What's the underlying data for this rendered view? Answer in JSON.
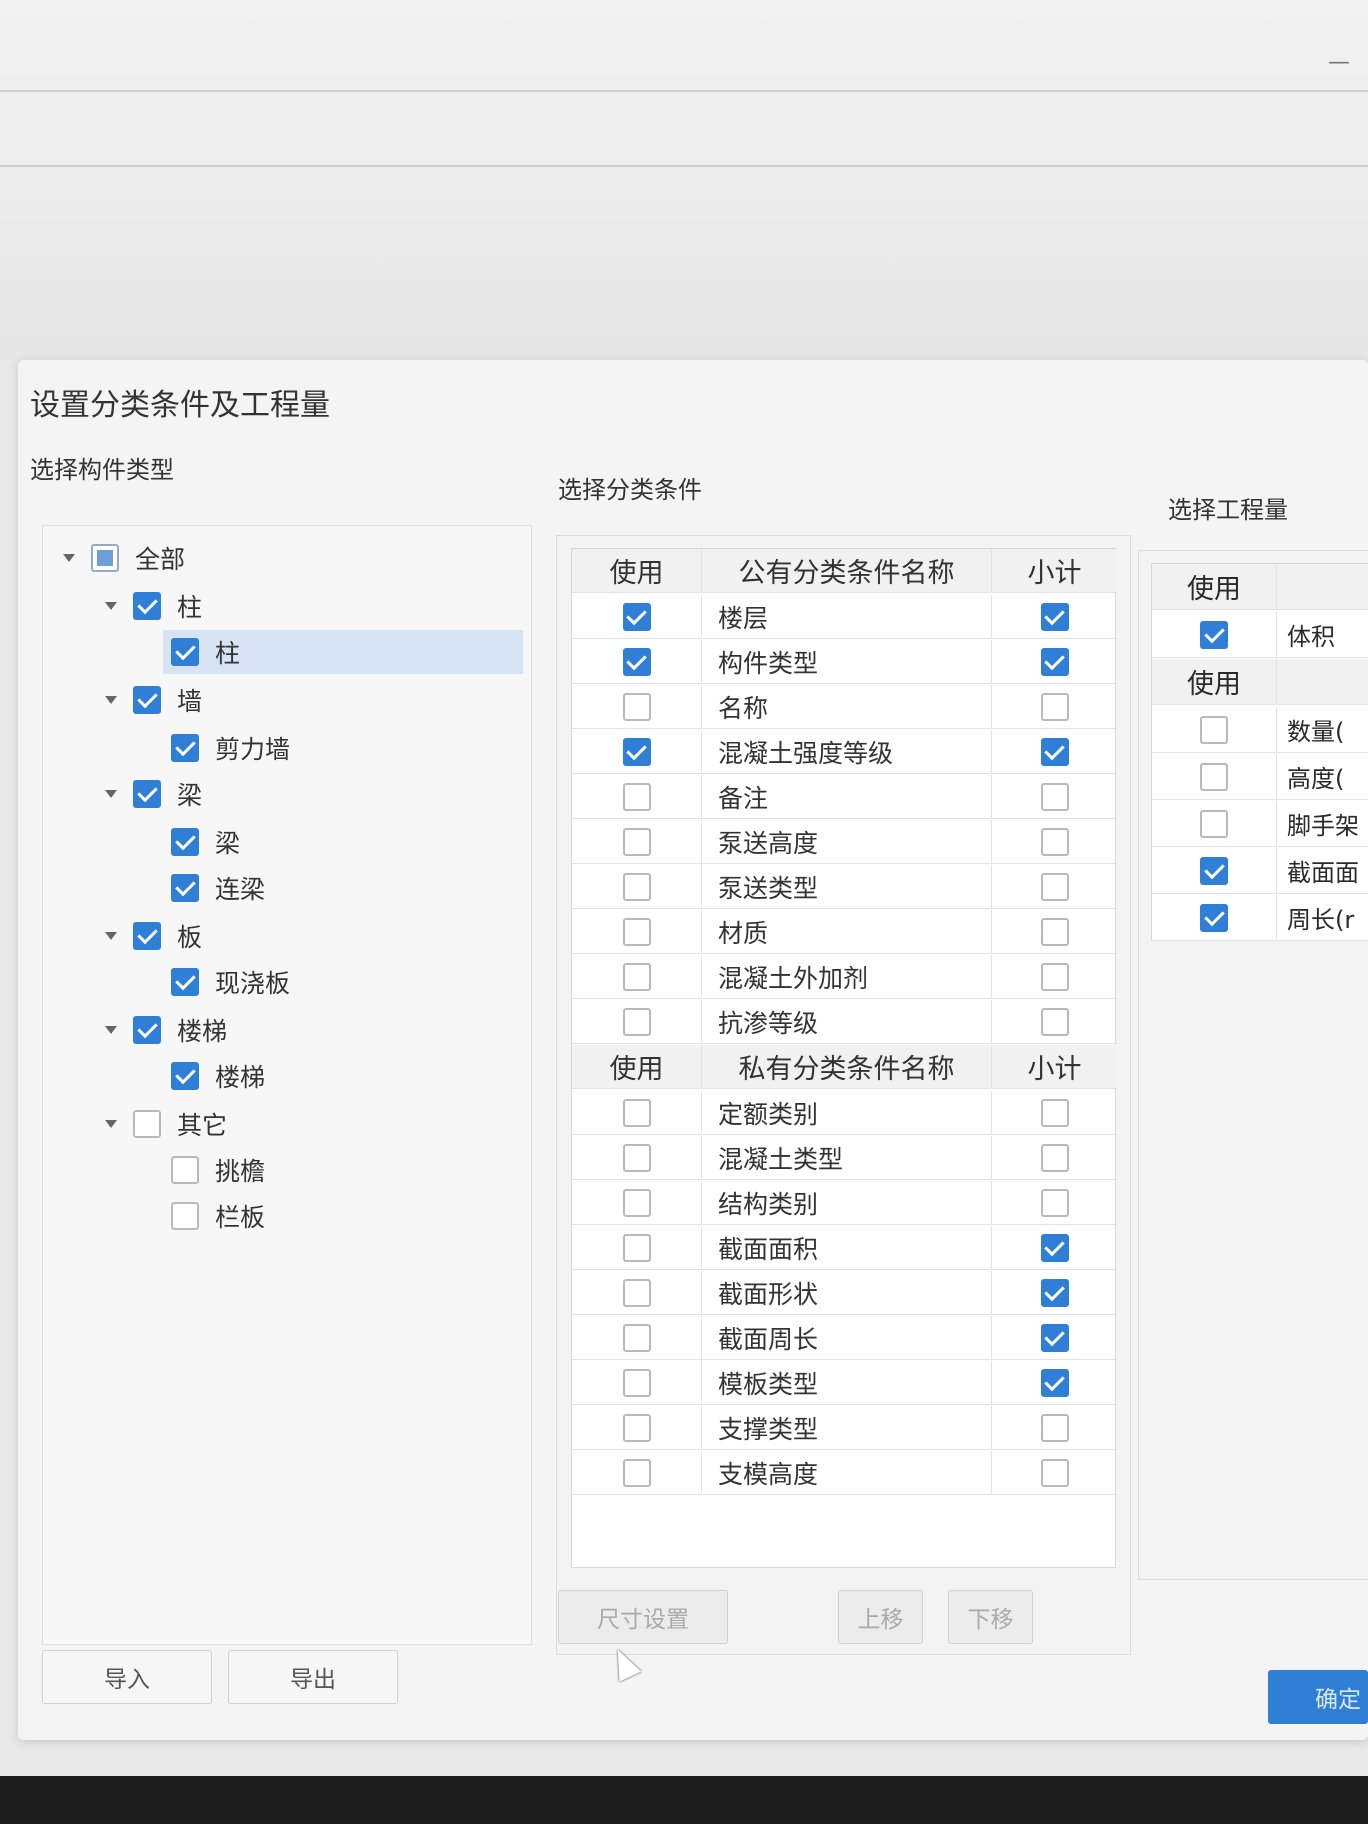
{
  "background": {
    "minimize_glyph": "—"
  },
  "dialog": {
    "title": "设置分类条件及工程量",
    "left": {
      "label": "选择构件类型",
      "tree": [
        {
          "label": "全部",
          "level": 0,
          "state": "partial",
          "expanded": true
        },
        {
          "label": "柱",
          "level": 1,
          "state": "checked",
          "expanded": true
        },
        {
          "label": "柱",
          "level": 2,
          "state": "checked",
          "selected": true
        },
        {
          "label": "墙",
          "level": 1,
          "state": "checked",
          "expanded": true
        },
        {
          "label": "剪力墙",
          "level": 2,
          "state": "checked"
        },
        {
          "label": "梁",
          "level": 1,
          "state": "checked",
          "expanded": true
        },
        {
          "label": "梁",
          "level": 2,
          "state": "checked"
        },
        {
          "label": "连梁",
          "level": 2,
          "state": "checked"
        },
        {
          "label": "板",
          "level": 1,
          "state": "checked",
          "expanded": true
        },
        {
          "label": "现浇板",
          "level": 2,
          "state": "checked"
        },
        {
          "label": "楼梯",
          "level": 1,
          "state": "checked",
          "expanded": true
        },
        {
          "label": "楼梯",
          "level": 2,
          "state": "checked"
        },
        {
          "label": "其它",
          "level": 1,
          "state": "unchecked",
          "expanded": true
        },
        {
          "label": "挑檐",
          "level": 2,
          "state": "unchecked"
        },
        {
          "label": "栏板",
          "level": 2,
          "state": "unchecked"
        }
      ],
      "import_label": "导入",
      "export_label": "导出"
    },
    "center": {
      "label": "选择分类条件",
      "public_header": {
        "use": "使用",
        "name": "公有分类条件名称",
        "subtotal": "小计"
      },
      "public_rows": [
        {
          "name": "楼层",
          "use": true,
          "subtotal": true
        },
        {
          "name": "构件类型",
          "use": true,
          "subtotal": true
        },
        {
          "name": "名称",
          "use": false,
          "subtotal": false
        },
        {
          "name": "混凝土强度等级",
          "use": true,
          "subtotal": true
        },
        {
          "name": "备注",
          "use": false,
          "subtotal": false
        },
        {
          "name": "泵送高度",
          "use": false,
          "subtotal": false
        },
        {
          "name": "泵送类型",
          "use": false,
          "subtotal": false
        },
        {
          "name": "材质",
          "use": false,
          "subtotal": false
        },
        {
          "name": "混凝土外加剂",
          "use": false,
          "subtotal": false
        },
        {
          "name": "抗渗等级",
          "use": false,
          "subtotal": false
        }
      ],
      "private_header": {
        "use": "使用",
        "name": "私有分类条件名称",
        "subtotal": "小计"
      },
      "private_rows": [
        {
          "name": "定额类别",
          "use": false,
          "subtotal": false
        },
        {
          "name": "混凝土类型",
          "use": false,
          "subtotal": false
        },
        {
          "name": "结构类别",
          "use": false,
          "subtotal": false
        },
        {
          "name": "截面面积",
          "use": false,
          "subtotal": true
        },
        {
          "name": "截面形状",
          "use": false,
          "subtotal": true
        },
        {
          "name": "截面周长",
          "use": false,
          "subtotal": true
        },
        {
          "name": "模板类型",
          "use": false,
          "subtotal": true
        },
        {
          "name": "支撑类型",
          "use": false,
          "subtotal": false
        },
        {
          "name": "支模高度",
          "use": false,
          "subtotal": false
        }
      ],
      "size_settings_label": "尺寸设置",
      "move_up_label": "上移",
      "move_down_label": "下移"
    },
    "right": {
      "label": "选择工程量",
      "header1": {
        "use": "使用"
      },
      "rows1": [
        {
          "name": "体积",
          "use": true
        }
      ],
      "header2": {
        "use": "使用"
      },
      "rows2": [
        {
          "name": "数量(",
          "use": false
        },
        {
          "name": "高度(",
          "use": false
        },
        {
          "name": "脚手架",
          "use": false
        },
        {
          "name": "截面面",
          "use": true
        },
        {
          "name": "周长(r",
          "use": true
        }
      ],
      "confirm_label": "确定"
    }
  }
}
